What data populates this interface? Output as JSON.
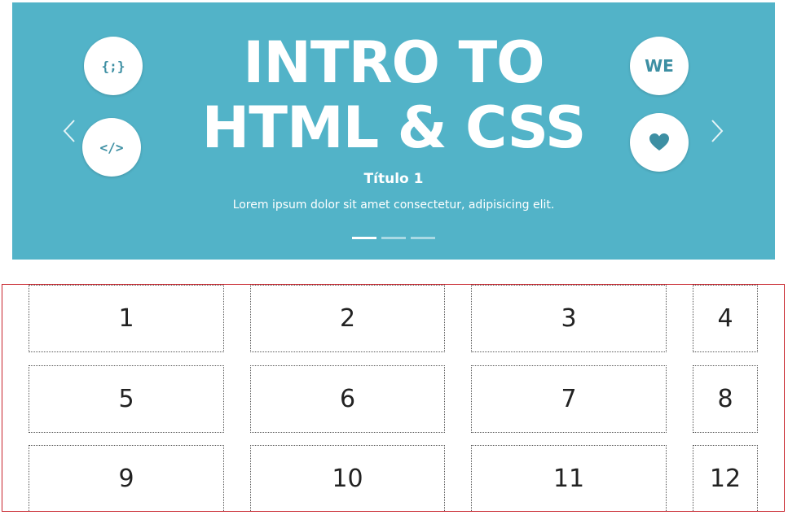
{
  "carousel": {
    "banner": {
      "headline_line1": "INTRO TO",
      "headline_line2": "HTML & CSS",
      "left_icons": [
        "{;}",
        "</>"
      ],
      "right_icons": [
        "WE",
        "heart-icon"
      ]
    },
    "caption": {
      "title": "Título 1",
      "text": "Lorem ipsum dolor sit amet consectetur, adipisicing elit."
    },
    "active_slide": 1,
    "slide_count": 3,
    "colors": {
      "banner_bg": "#52b3c8",
      "icon_fg": "#3d8fa3"
    }
  },
  "grid": {
    "border_color": "#c8242c",
    "cells": [
      "1",
      "2",
      "3",
      "4",
      "5",
      "6",
      "7",
      "8",
      "9",
      "10",
      "11",
      "12"
    ]
  }
}
